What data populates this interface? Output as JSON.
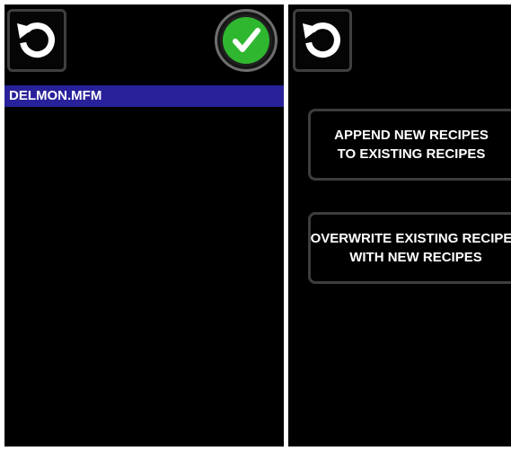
{
  "left_panel": {
    "reset_icon": "refresh-icon",
    "confirm_icon": "checkmark-icon",
    "files": [
      {
        "name": "DELMON.MFM",
        "selected": true
      }
    ]
  },
  "right_panel": {
    "reset_icon": "refresh-icon",
    "options": [
      {
        "line1": "APPEND NEW RECIPES",
        "line2": "TO EXISTING RECIPES"
      },
      {
        "line1": "OVERWRITE EXISTING RECIPES",
        "line2": "WITH NEW RECIPES"
      }
    ]
  },
  "colors": {
    "background": "#000000",
    "selection": "#29219a",
    "check_green": "#2fb82f",
    "divider": "#ffffff"
  }
}
